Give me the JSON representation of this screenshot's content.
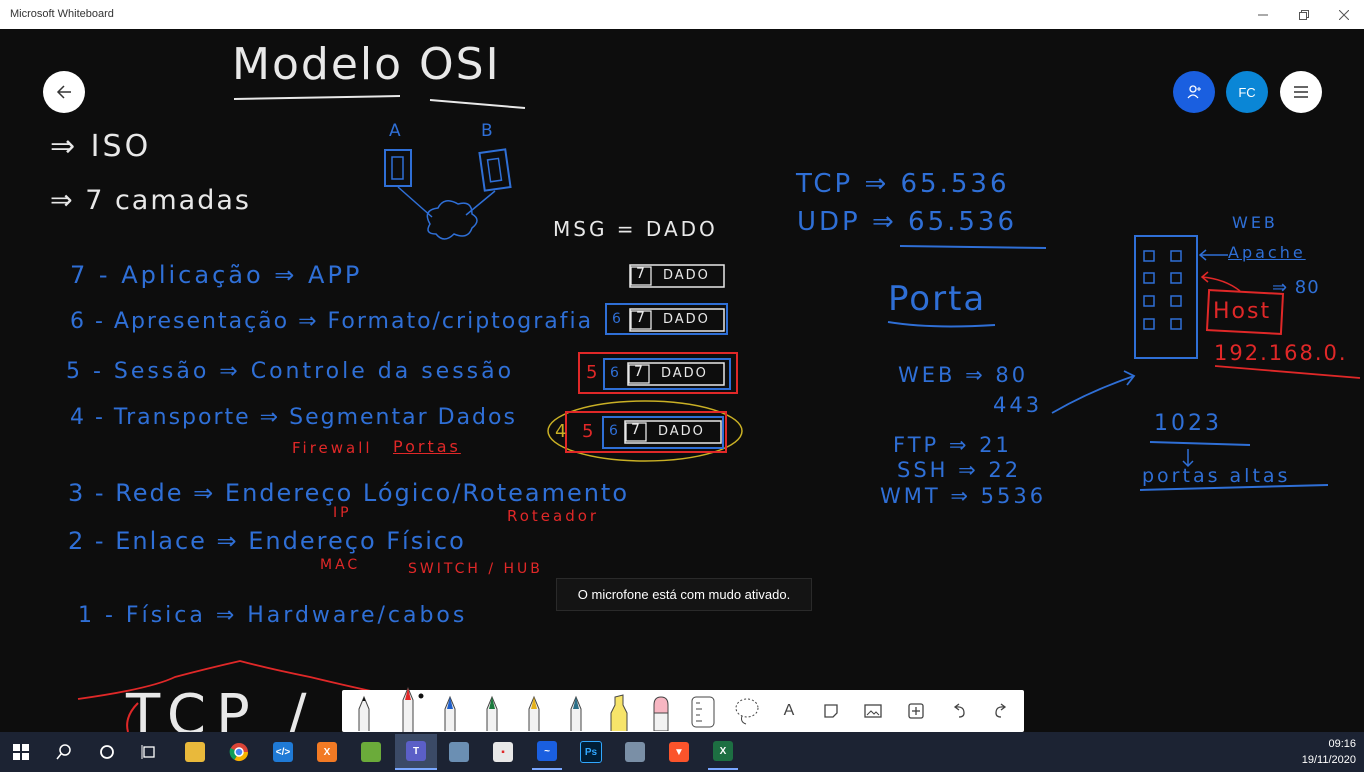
{
  "window": {
    "title": "Microsoft Whiteboard"
  },
  "header": {
    "user_initials": "FC"
  },
  "board": {
    "title": "Modelo OSI",
    "iso": "⇒ ISO",
    "layers_count": "⇒ 7 camadas",
    "host_a": "A",
    "host_b": "B",
    "msg": "MSG = DADO",
    "layers": [
      {
        "text": "7 - Aplicação ⇒ APP"
      },
      {
        "text": "6 - Apresentação ⇒ Formato/criptografia"
      },
      {
        "text": "5 - Sessão ⇒ Controle da sessão"
      },
      {
        "text": "4 - Transporte ⇒ Segmentar Dados"
      },
      {
        "text": "3 - Rede ⇒ Endereço Lógico/Roteamento"
      },
      {
        "text": "2 - Enlace ⇒ Endereço Físico"
      },
      {
        "text": "1 - Física ⇒ Hardware/cabos"
      }
    ],
    "red_notes": {
      "firewall": "Firewall",
      "portas": "Portas",
      "ip": "IP",
      "roteador": "Roteador",
      "mac": "MAC",
      "switch_hub": "SWITCH / HUB"
    },
    "encap": {
      "n7": "7",
      "n6": "6",
      "n5": "5",
      "n4": "4",
      "dado": "DADO"
    },
    "tcp": "TCP ⇒ 65.536",
    "udp": "UDP ⇒ 65.536",
    "porta": "Porta",
    "ports": {
      "web": "WEB ⇒ 80",
      "web2": "443",
      "ftp": "FTP ⇒ 21",
      "ssh": "SSH ⇒ 22",
      "wmt": "WMT ⇒ 5536"
    },
    "server": {
      "web": "WEB",
      "apache": "Apache",
      "port80": "⇒ 80",
      "host": "Host",
      "ip": "192.168.0."
    },
    "range": {
      "n1023": "1023",
      "altas": "portas altas"
    },
    "tcp_bottom": "TCP / I"
  },
  "toast": {
    "text": "O microfone está com mudo ativado."
  },
  "toolbar": {
    "text_tool": "A"
  },
  "taskbar": {
    "time": "09:16",
    "date": "19/11/2020"
  }
}
